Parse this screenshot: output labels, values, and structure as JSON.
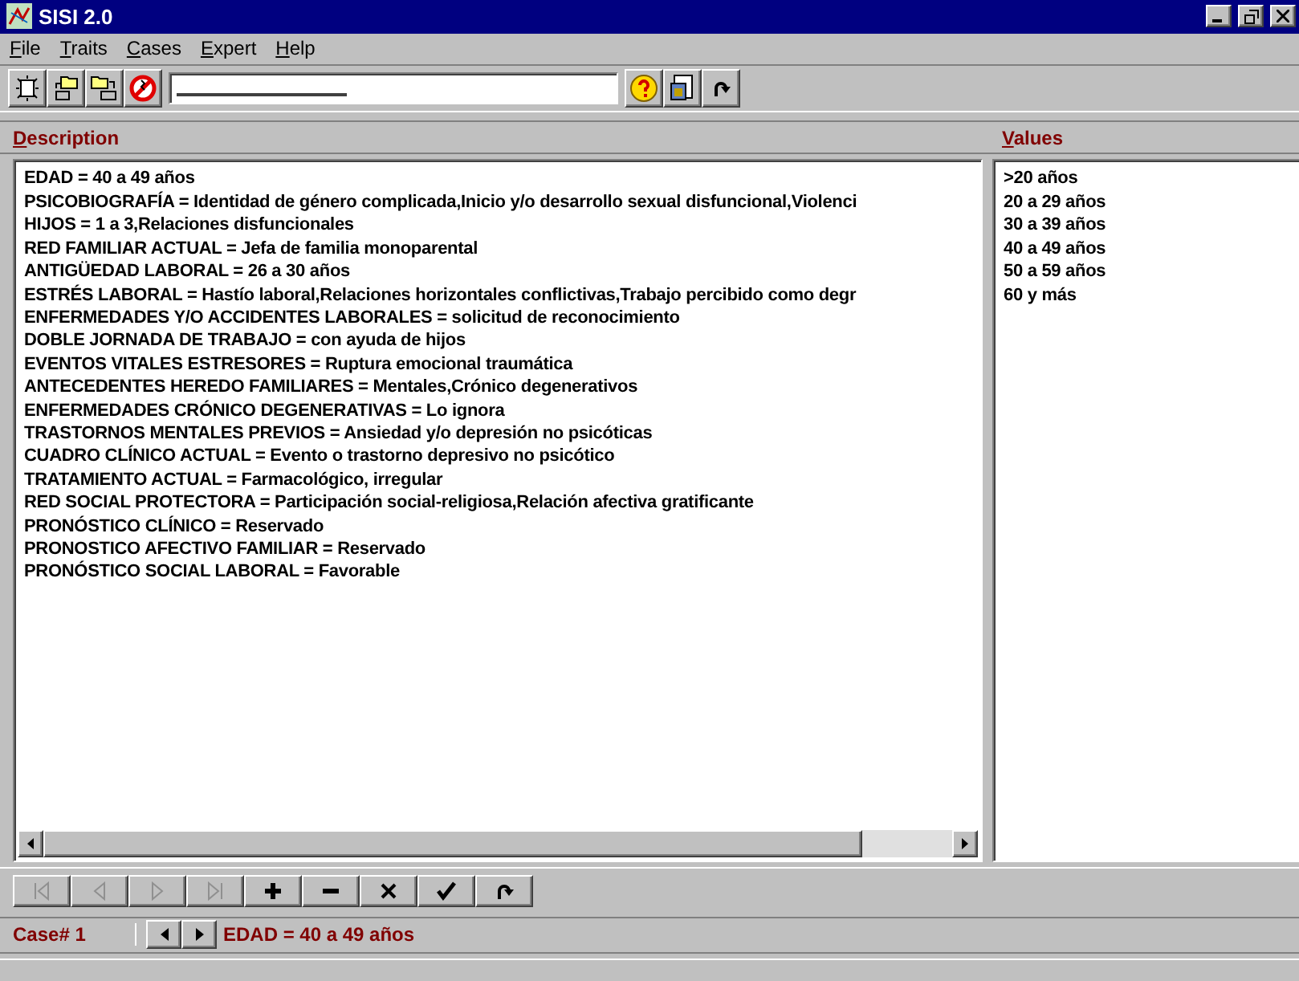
{
  "window": {
    "title": "SISI 2.0"
  },
  "menu": [
    "File",
    "Traits",
    "Cases",
    "Expert",
    "Help"
  ],
  "toolbar": {
    "left": [
      {
        "kind": "new"
      },
      {
        "kind": "open"
      },
      {
        "kind": "save"
      },
      {
        "kind": "stop"
      }
    ],
    "right": [
      {
        "kind": "help"
      },
      {
        "kind": "report"
      },
      {
        "kind": "redo"
      }
    ]
  },
  "headers": {
    "description": "Description",
    "values": "Values"
  },
  "description": [
    "EDAD = 40 a 49 años",
    "PSICOBIOGRAFÍA = Identidad de género complicada,Inicio y/o desarrollo sexual disfuncional,Violenci",
    "HIJOS = 1 a 3,Relaciones disfuncionales",
    "RED FAMILIAR ACTUAL = Jefa de familia monoparental",
    "ANTIGÜEDAD LABORAL = 26 a 30 años",
    "ESTRÉS LABORAL = Hastío laboral,Relaciones horizontales conflictivas,Trabajo percibido como degr",
    "ENFERMEDADES Y/O ACCIDENTES LABORALES =  solicitud de reconocimiento",
    "DOBLE JORNADA DE TRABAJO =  con ayuda de hijos",
    "EVENTOS VITALES ESTRESORES = Ruptura emocional traumática",
    "ANTECEDENTES HEREDO FAMILIARES = Mentales,Crónico degenerativos",
    "ENFERMEDADES CRÓNICO DEGENERATIVAS = Lo ignora",
    "TRASTORNOS MENTALES PREVIOS = Ansiedad y/o depresión no psicóticas",
    "CUADRO CLÍNICO ACTUAL = Evento o trastorno depresivo no psicótico",
    "TRATAMIENTO ACTUAL = Farmacológico, irregular",
    "RED SOCIAL PROTECTORA = Participación social-religiosa,Relación afectiva gratificante",
    "PRONÓSTICO CLÍNICO = Reservado",
    "PRONOSTICO AFECTIVO FAMILIAR = Reservado",
    "PRONÓSTICO SOCIAL LABORAL = Favorable"
  ],
  "values": [
    ">20 años",
    "20 a 29 años",
    "30 a 39 años",
    "40 a 49 años",
    "50 a 59 años",
    "60 y más"
  ],
  "nav_buttons": [
    {
      "kind": "first",
      "disabled": true
    },
    {
      "kind": "prev",
      "disabled": true
    },
    {
      "kind": "next",
      "disabled": true
    },
    {
      "kind": "last",
      "disabled": true
    },
    {
      "kind": "add",
      "disabled": false
    },
    {
      "kind": "remove",
      "disabled": false
    },
    {
      "kind": "delete",
      "disabled": false
    },
    {
      "kind": "confirm",
      "disabled": false
    },
    {
      "kind": "refresh",
      "disabled": false
    }
  ],
  "status": {
    "case_label": "Case# 1",
    "current_trait": "EDAD = 40 a 49 años"
  }
}
